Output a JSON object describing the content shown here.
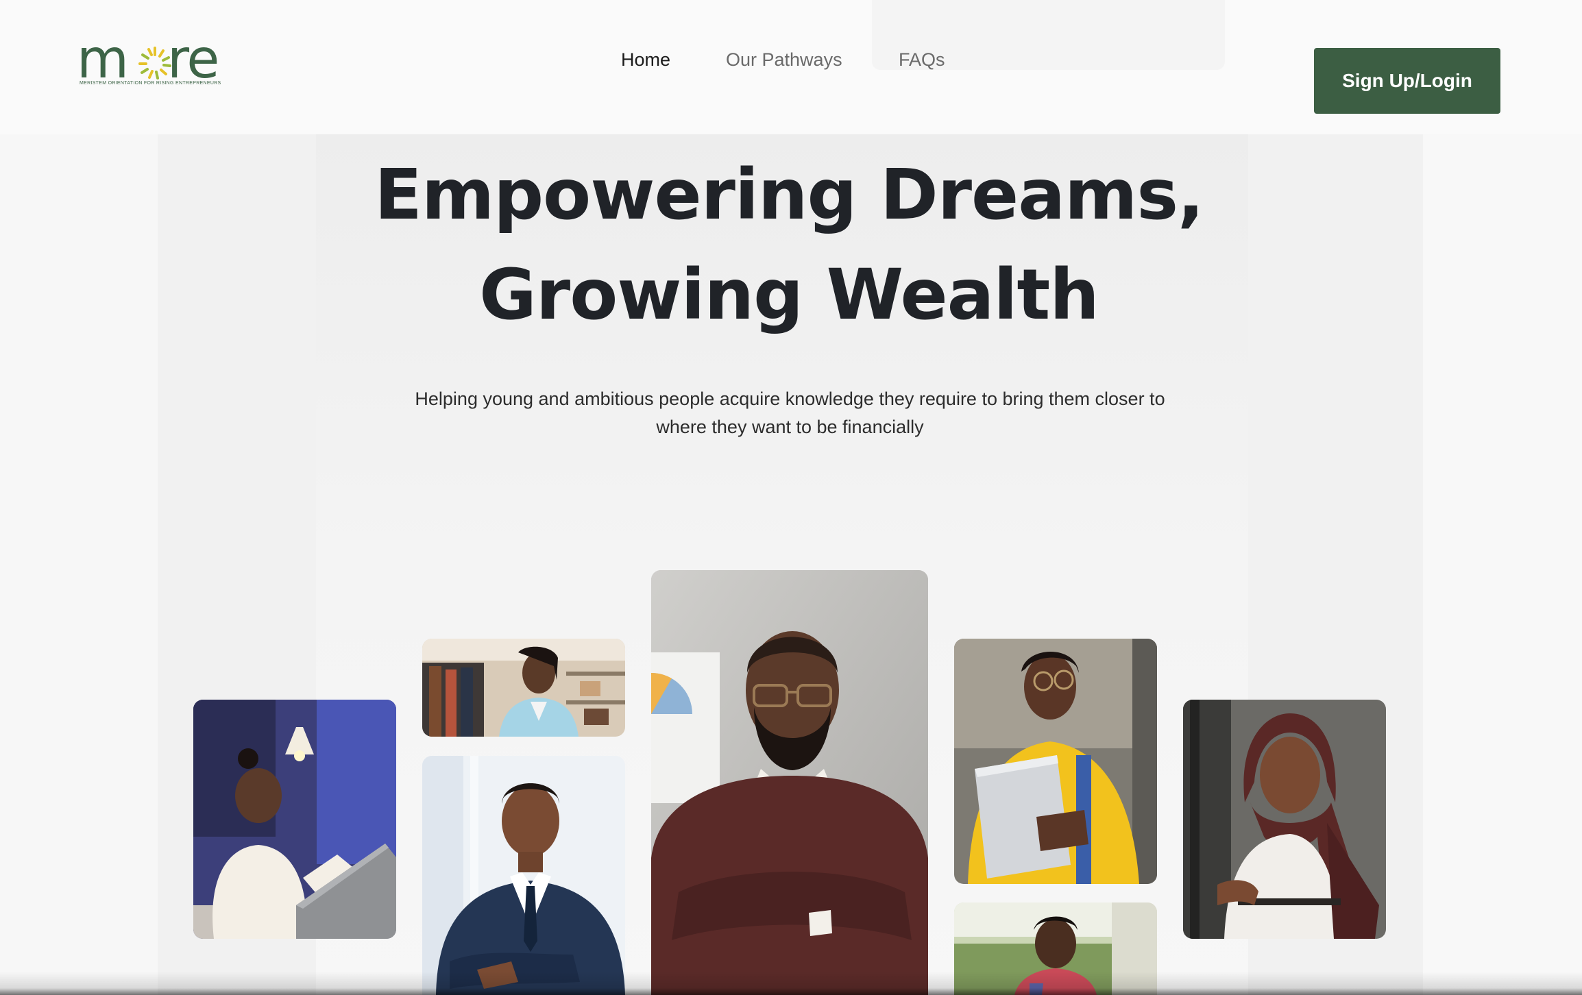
{
  "brand": {
    "logo_text_m": "m",
    "logo_text_re": "re",
    "tagline": "MERISTEM ORIENTATION FOR RISING ENTREPRENEURS",
    "primary_color": "#3c5e43",
    "sun_colors": [
      "#e6c229",
      "#9dbb3a"
    ]
  },
  "nav": {
    "items": [
      {
        "label": "Home",
        "active": true
      },
      {
        "label": "Our Pathways",
        "active": false
      },
      {
        "label": "FAQs",
        "active": false
      }
    ],
    "cta_label": "Sign Up/Login"
  },
  "hero": {
    "title_line1": "Empowering Dreams,",
    "title_line2": "Growing Wealth",
    "subtitle_line1": "Helping young and ambitious people acquire knowledge they require to bring them closer to",
    "subtitle_line2": "where they want to be financially"
  },
  "gallery": {
    "photos": [
      {
        "name": "woman-laptop-photo"
      },
      {
        "name": "woman-boutique-photo"
      },
      {
        "name": "man-suit-photo"
      },
      {
        "name": "man-glasses-sweater-photo"
      },
      {
        "name": "woman-yellow-sweater-photo"
      },
      {
        "name": "young-man-outdoor-photo"
      },
      {
        "name": "woman-hijab-photo"
      }
    ]
  }
}
